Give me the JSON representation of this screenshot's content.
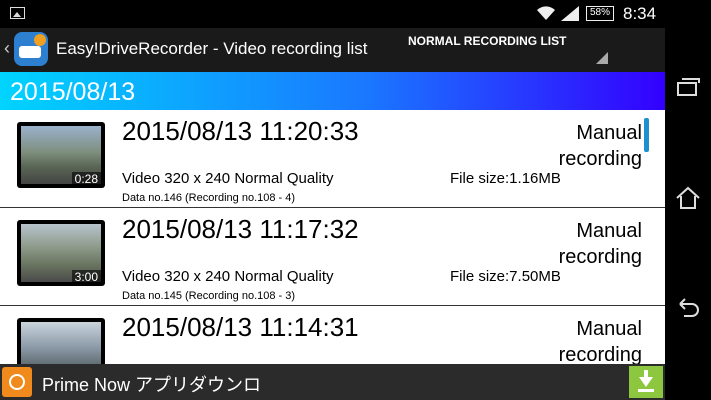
{
  "status": {
    "battery": "58%",
    "time": "8:34"
  },
  "appbar": {
    "title": "Easy!DriveRecorder - Video recording list",
    "spinner_label": "NORMAL RECORDING LIST"
  },
  "date_header": "2015/08/13",
  "recordings": [
    {
      "datetime": "2015/08/13 11:20:33",
      "type": "Manual recording",
      "quality": "Video 320 x 240 Normal Quality",
      "size": "File size:1.16MB",
      "data_no": "Data no.146 (Recording no.108 - 4)",
      "duration": "0:28"
    },
    {
      "datetime": "2015/08/13 11:17:32",
      "type": "Manual recording",
      "quality": "Video 320 x 240 Normal Quality",
      "size": "File size:7.50MB",
      "data_no": "Data no.145 (Recording no.108 - 3)",
      "duration": "3:00"
    },
    {
      "datetime": "2015/08/13 11:14:31",
      "type": "Manual recording",
      "quality": "",
      "size": "",
      "data_no": "",
      "duration": ""
    }
  ],
  "ad": {
    "text": "Prime Now アプリダウンロ"
  },
  "icons": {
    "gallery": "image-icon",
    "wifi": "wifi-icon",
    "signal": "signal-icon",
    "download": "download-icon",
    "recent": "recent-apps-icon",
    "home": "home-icon",
    "back": "back-icon"
  },
  "colors": {
    "header_gradient_start": "#00d4ff",
    "header_gradient_end": "#3300ff",
    "scrollbar": "#1e90d0",
    "download_button": "#8dc63f",
    "ad_icon": "#f08a1c"
  }
}
